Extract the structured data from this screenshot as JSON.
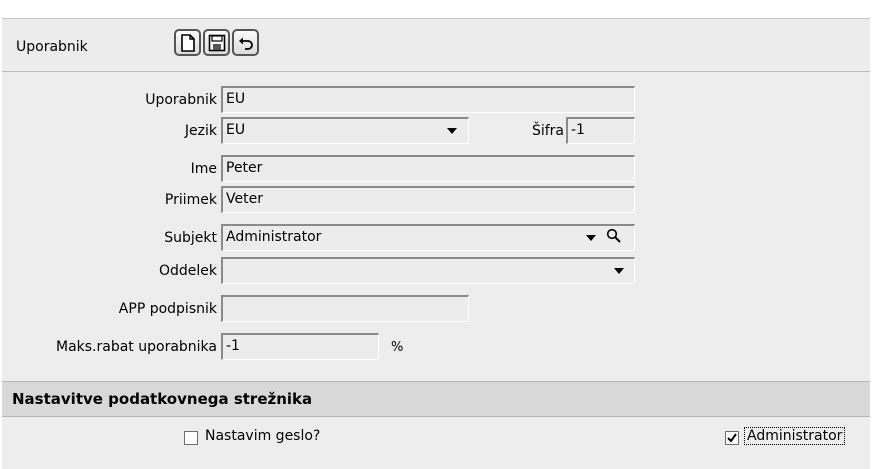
{
  "header": {
    "title": "Uporabnik"
  },
  "toolbar": {
    "buttons": [
      {
        "name": "new-document-icon"
      },
      {
        "name": "save-icon"
      },
      {
        "name": "undo-icon"
      }
    ]
  },
  "form": {
    "uporabnik": {
      "label": "Uporabnik",
      "value": "EU"
    },
    "jezik": {
      "label": "Jezik",
      "value": "EU"
    },
    "sifra": {
      "label": "Šifra",
      "value": "-1"
    },
    "ime": {
      "label": "Ime",
      "value": "Peter"
    },
    "priimek": {
      "label": "Priimek",
      "value": "Veter"
    },
    "subjekt": {
      "label": "Subjekt",
      "value": "Administrator"
    },
    "oddelek": {
      "label": "Oddelek",
      "value": ""
    },
    "app_podpisnik": {
      "label": "APP podpisnik",
      "value": ""
    },
    "maks_rabat": {
      "label": "Maks.rabat uporabnika",
      "value": "-1",
      "unit": "%"
    }
  },
  "server_settings": {
    "title": "Nastavitve podatkovnega strežnika",
    "set_password": {
      "label": "Nastavim geslo?",
      "checked": false
    },
    "administrator": {
      "label": "Administrator",
      "checked": true
    }
  }
}
